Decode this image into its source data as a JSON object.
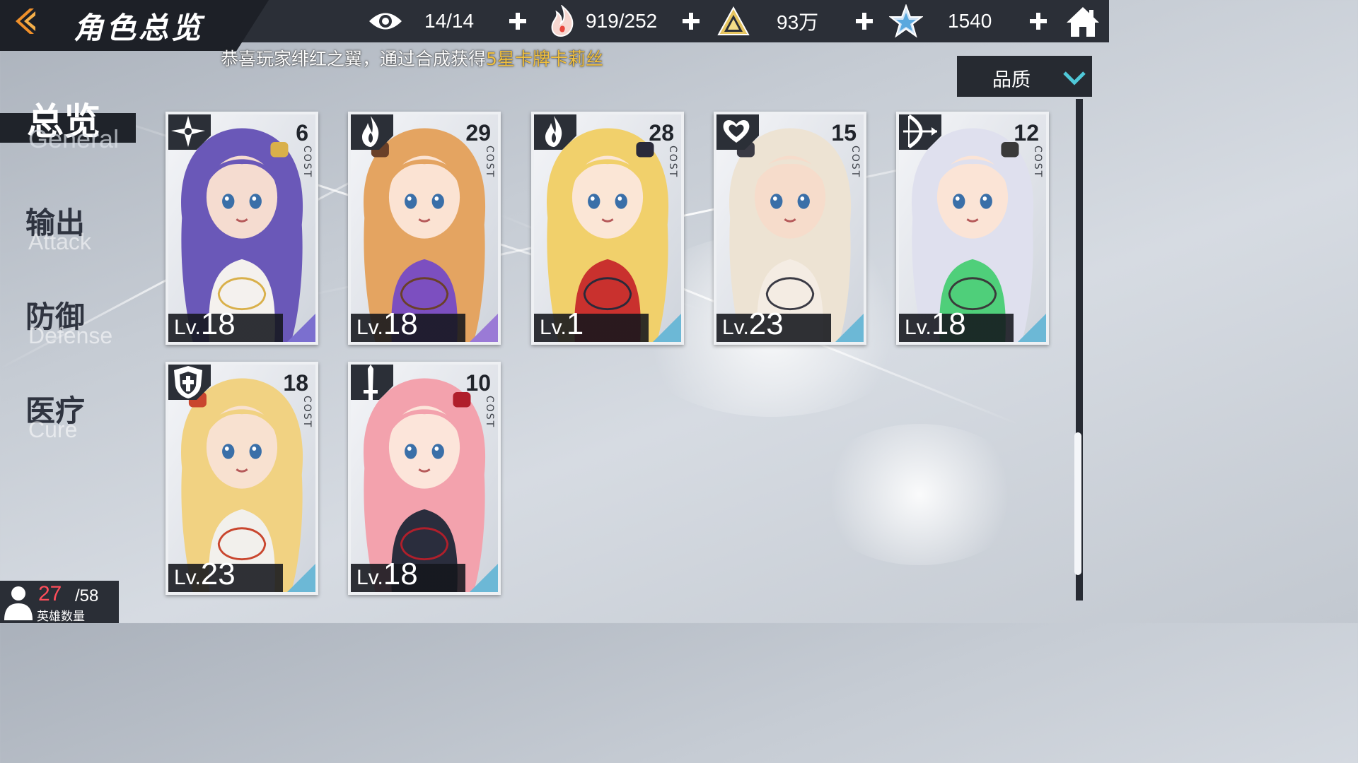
{
  "header": {
    "title": "角色总览",
    "resources": [
      {
        "icon": "eye-icon",
        "value": "14/14"
      },
      {
        "icon": "flame-hand-icon",
        "value": "919/252"
      },
      {
        "icon": "triangle-crystal-icon",
        "value": "93万"
      },
      {
        "icon": "star-icon",
        "value": "1540"
      }
    ],
    "home_icon": "home-icon"
  },
  "marquee": {
    "prefix": "恭喜玩家绯红之翼，通过合成获得",
    "highlight": "5星卡牌卡莉丝"
  },
  "sort": {
    "label": "品质"
  },
  "nav": [
    {
      "cn": "总览",
      "en": "General",
      "active": true
    },
    {
      "cn": "输出",
      "en": "Attack",
      "active": false
    },
    {
      "cn": "防御",
      "en": "Defense",
      "active": false
    },
    {
      "cn": "医疗",
      "en": "Cure",
      "active": false
    }
  ],
  "heroes": [
    {
      "cost": "6",
      "cost_label": "COST",
      "level_prefix": "Lv.",
      "level": "18",
      "class_icon": "shuriken-icon",
      "palette": {
        "hair": "#6a58b8",
        "skin": "#f5dcd0",
        "outfit": "#f4f1ee",
        "accent": "#d9b04a",
        "corner": "#7b6fcf"
      }
    },
    {
      "cost": "29",
      "cost_label": "COST",
      "level_prefix": "Lv.",
      "level": "18",
      "class_icon": "fire-icon",
      "palette": {
        "hair": "#e4a461",
        "skin": "#fbe3d3",
        "outfit": "#7c4fc0",
        "accent": "#6a4028",
        "corner": "#9a7ad6"
      }
    },
    {
      "cost": "28",
      "cost_label": "COST",
      "level_prefix": "Lv.",
      "level": "1",
      "class_icon": "fire-icon",
      "palette": {
        "hair": "#f1d06b",
        "skin": "#fbe6d6",
        "outfit": "#c9312e",
        "accent": "#2a2a3a",
        "corner": "#6cb8d6"
      }
    },
    {
      "cost": "15",
      "cost_label": "COST",
      "level_prefix": "Lv.",
      "level": "23",
      "class_icon": "heart-wing-icon",
      "palette": {
        "hair": "#ede3d3",
        "skin": "#f6dccb",
        "outfit": "#f4ece3",
        "accent": "#3a3a44",
        "corner": "#6cb8d6"
      }
    },
    {
      "cost": "12",
      "cost_label": "COST",
      "level_prefix": "Lv.",
      "level": "18",
      "class_icon": "bow-icon",
      "palette": {
        "hair": "#dfe0ee",
        "skin": "#fbe4d6",
        "outfit": "#4fcf7a",
        "accent": "#3a3a3a",
        "corner": "#6cb8d6"
      }
    },
    {
      "cost": "18",
      "cost_label": "COST",
      "level_prefix": "Lv.",
      "level": "23",
      "class_icon": "shield-icon",
      "palette": {
        "hair": "#f1d282",
        "skin": "#f8e1d0",
        "outfit": "#f2f0ec",
        "accent": "#c9462e",
        "corner": "#6cb8d6"
      }
    },
    {
      "cost": "10",
      "cost_label": "COST",
      "level_prefix": "Lv.",
      "level": "18",
      "class_icon": "sword-icon",
      "palette": {
        "hair": "#f3a2ad",
        "skin": "#fce5da",
        "outfit": "#2a2d3d",
        "accent": "#b01f2b",
        "corner": "#6cb8d6"
      }
    }
  ],
  "hero_count": {
    "current": "27",
    "max": "/58",
    "label": "英雄数量"
  }
}
